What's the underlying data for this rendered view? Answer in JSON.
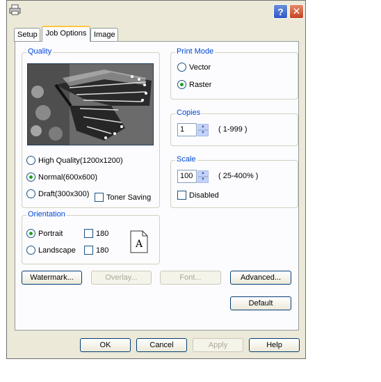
{
  "window": {
    "help_symbol": "?",
    "close_symbol": "✕"
  },
  "tabs": [
    {
      "label": "Setup",
      "active": false
    },
    {
      "label": "Job Options",
      "active": true
    },
    {
      "label": "Image",
      "active": false
    }
  ],
  "quality": {
    "label": "Quality",
    "options": [
      "High Quality(1200x1200)",
      "Normal(600x600)",
      "Draft(300x300)"
    ],
    "selected": "Normal(600x600)",
    "toner_saving_label": "Toner Saving",
    "toner_saving_checked": false
  },
  "print_mode": {
    "label": "Print Mode",
    "options": [
      "Vector",
      "Raster"
    ],
    "selected": "Raster"
  },
  "copies": {
    "label": "Copies",
    "value": "1",
    "range": "( 1-999 )"
  },
  "scale": {
    "label": "Scale",
    "value": "100",
    "range": "( 25-400% )",
    "disabled_label": "Disabled",
    "disabled_checked": false
  },
  "orientation": {
    "label": "Orientation",
    "portrait_label": "Portrait",
    "landscape_label": "Landscape",
    "selected": "Portrait",
    "rotate_label_1": "180",
    "rotate_label_2": "180",
    "preview_letter": "A"
  },
  "panel_buttons": {
    "watermark": "Watermark...",
    "overlay": "Overlay...",
    "font": "Font...",
    "advanced": "Advanced...",
    "default": "Default"
  },
  "footer_buttons": {
    "ok": "OK",
    "cancel": "Cancel",
    "apply": "Apply",
    "help": "Help"
  },
  "colors": {
    "group_label": "#0046d5",
    "radio_dot": "#21a121",
    "dialog_bg": "#ece9d8",
    "close_red": "#c44421"
  }
}
